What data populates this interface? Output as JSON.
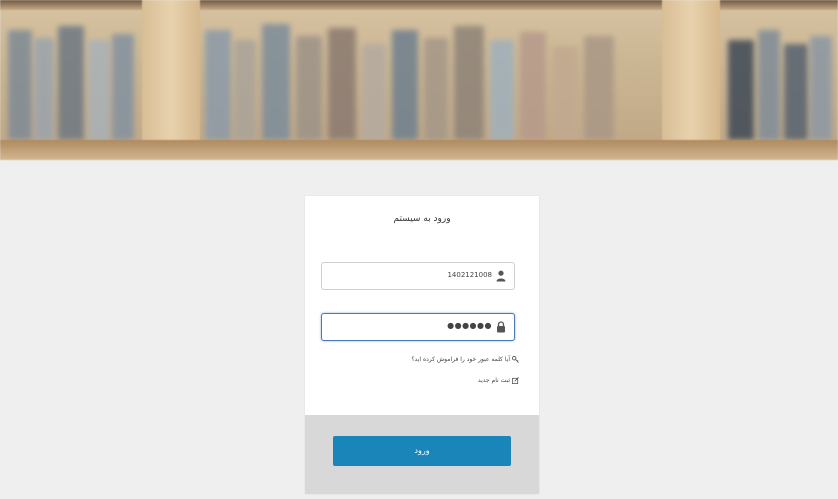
{
  "login": {
    "title": "ورود به سیستم",
    "username_value": "1402121008",
    "password_value": "●●●●●●",
    "forgot_password": "آیا کلمه عبور خود را فراموش کرده اید؟",
    "register": "ثبت نام جدید",
    "submit_label": "ورود"
  },
  "icons": {
    "username": "user-icon",
    "password": "lock-icon",
    "forgot": "key-icon",
    "register": "edit-icon"
  },
  "colors": {
    "submit": "#1a85b8",
    "active_border": "#4a78b8",
    "footer": "#d8d8d8",
    "background": "#efefef"
  }
}
